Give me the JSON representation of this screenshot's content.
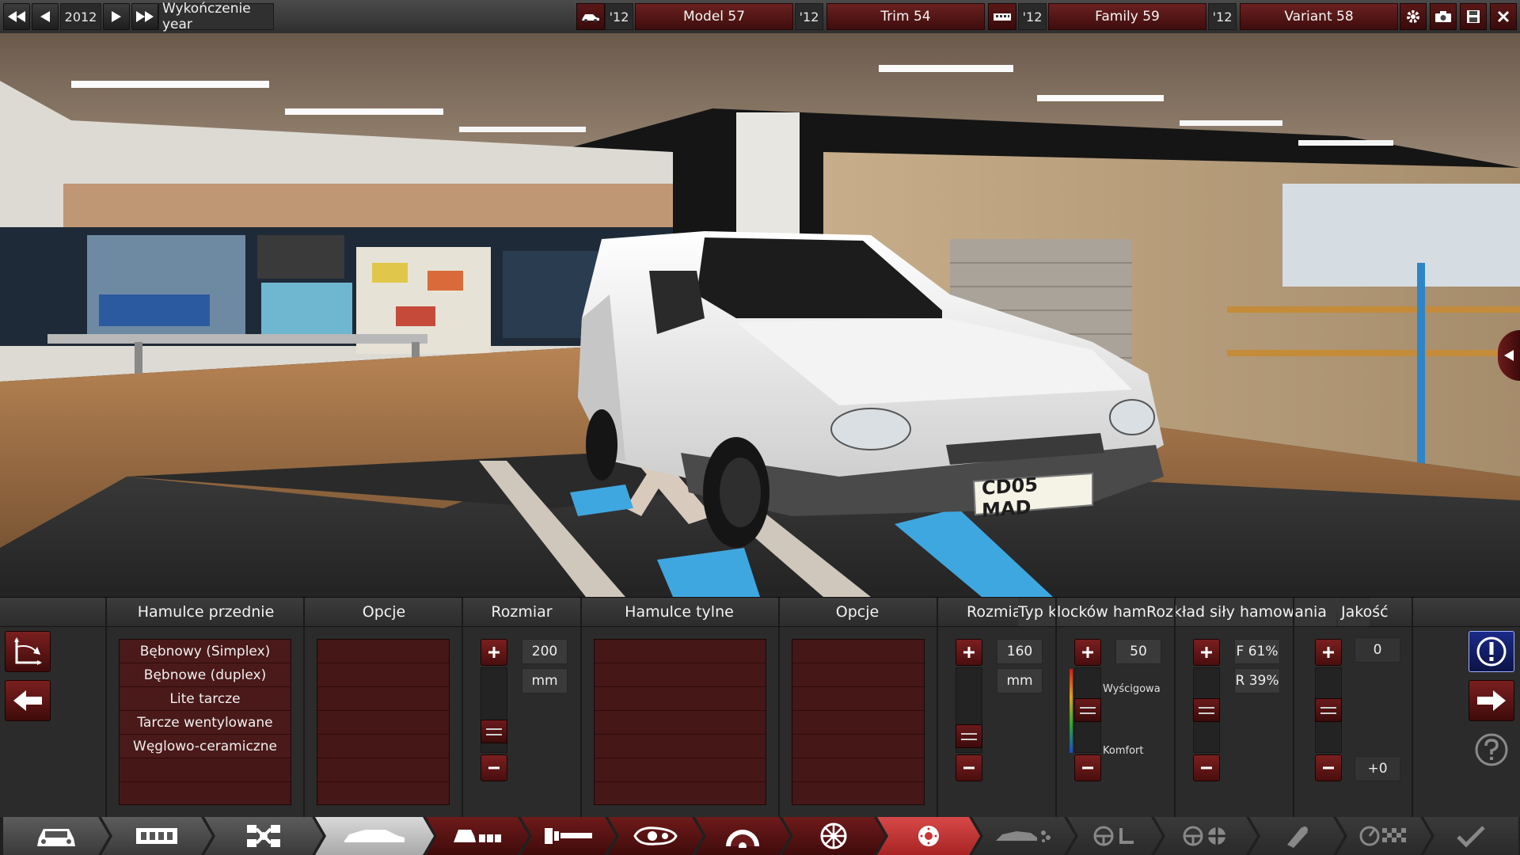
{
  "topbar": {
    "year": "2012",
    "trim_label": "Wykończenie year",
    "car_year": "'12",
    "model": "Model 57",
    "trim_year": "'12",
    "trim": "Trim 54",
    "family_year": "'12",
    "family": "Family 59",
    "variant_year": "'12",
    "variant": "Variant 58"
  },
  "scene": {
    "plate": "CD05 MAD"
  },
  "panel": {
    "headers": {
      "front_brakes": "Hamulce przednie",
      "front_options": "Opcje",
      "front_size": "Rozmiar",
      "rear_brakes": "Hamulce tylne",
      "rear_options": "Opcje",
      "rear_size": "Rozmiar",
      "pad_type": "Typ klocków hamulcowych",
      "bias": "Rozkład siły hamowania",
      "quality": "Jakość"
    },
    "front_brake_types": [
      "Bębnowy (Simplex)",
      "Bębnowe (duplex)",
      "Lite tarcze",
      "Tarcze wentylowane",
      "Węglowo-ceramiczne"
    ],
    "front_size": {
      "value": "200",
      "unit": "mm",
      "level": 0.15
    },
    "rear_size": {
      "value": "160",
      "unit": "mm",
      "level": 0.08
    },
    "pad": {
      "value": "50",
      "label_top": "Wyścigowa",
      "label_bottom": "Komfort",
      "level": 0.5
    },
    "bias": {
      "front": "F 61%",
      "rear": "R 39%",
      "level": 0.5
    },
    "quality": {
      "value": "0",
      "delta": "+0",
      "level": 0.5
    }
  },
  "colors": {
    "accent": "#5a1313",
    "panel_bg": "#2b2b2b",
    "active_tab": "#c9c9c9"
  }
}
